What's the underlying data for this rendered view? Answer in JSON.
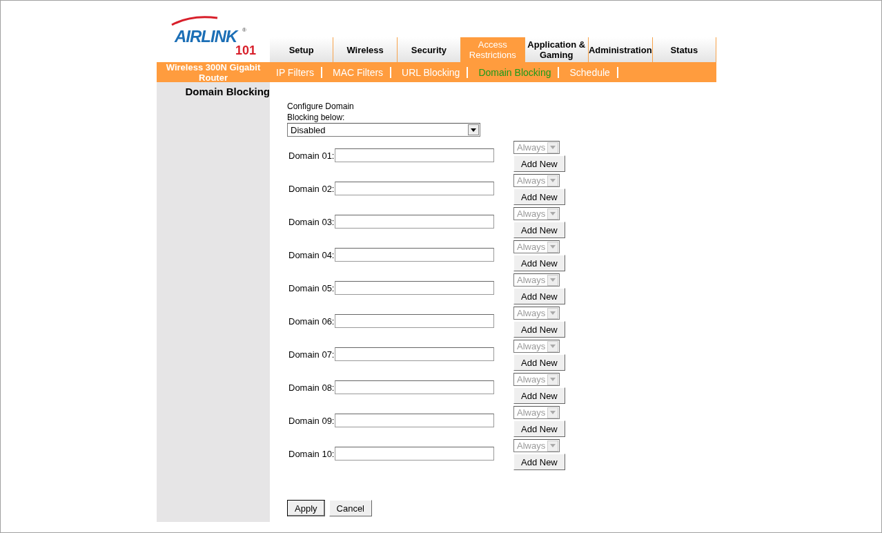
{
  "logo": {
    "brand": "AIRLINK",
    "mark": "®",
    "number": "101"
  },
  "product": "Wireless 300N Gigabit Router",
  "tabs": [
    {
      "label": "Setup",
      "selected": false
    },
    {
      "label": "Wireless",
      "selected": false
    },
    {
      "label": "Security",
      "selected": false
    },
    {
      "label": "Access Restrictions",
      "selected": true
    },
    {
      "label": "Application & Gaming",
      "selected": false
    },
    {
      "label": "Administration",
      "selected": false
    },
    {
      "label": "Status",
      "selected": false
    }
  ],
  "subtabs": [
    {
      "label": "IP Filters",
      "selected": false
    },
    {
      "label": "MAC Filters",
      "selected": false
    },
    {
      "label": "URL Blocking",
      "selected": false
    },
    {
      "label": "Domain Blocking",
      "selected": true
    },
    {
      "label": "Schedule",
      "selected": false
    }
  ],
  "sidebar_title": "Domain Blocking",
  "configure_label": "Configure Domain Blocking below:",
  "mode_select": {
    "value": "Disabled"
  },
  "domains": [
    {
      "label": "Domain 01:",
      "schedule": "Always",
      "schedule_disabled": true,
      "button": "Add New"
    },
    {
      "label": "Domain 02:",
      "schedule": "Always",
      "schedule_disabled": true,
      "button": "Add New"
    },
    {
      "label": "Domain 03:",
      "schedule": "Always",
      "schedule_disabled": true,
      "button": "Add New"
    },
    {
      "label": "Domain 04:",
      "schedule": "Always",
      "schedule_disabled": true,
      "button": "Add New"
    },
    {
      "label": "Domain 05:",
      "schedule": "Always",
      "schedule_disabled": true,
      "button": "Add New"
    },
    {
      "label": "Domain 06:",
      "schedule": "Always",
      "schedule_disabled": true,
      "button": "Add New"
    },
    {
      "label": "Domain 07:",
      "schedule": "Always",
      "schedule_disabled": true,
      "button": "Add New"
    },
    {
      "label": "Domain 08:",
      "schedule": "Always",
      "schedule_disabled": true,
      "button": "Add New"
    },
    {
      "label": "Domain 09:",
      "schedule": "Always",
      "schedule_disabled": true,
      "button": "Add New"
    },
    {
      "label": "Domain 10:",
      "schedule": "Always",
      "schedule_disabled": true,
      "button": "Add New"
    }
  ],
  "buttons": [
    {
      "label": "Apply",
      "kind": "default"
    },
    {
      "label": "Cancel",
      "kind": "normal"
    }
  ]
}
